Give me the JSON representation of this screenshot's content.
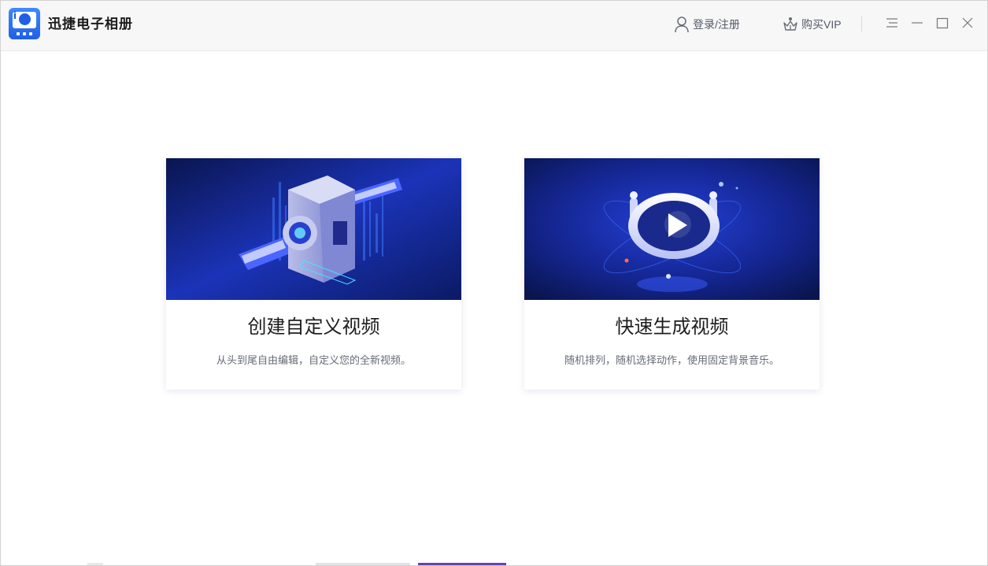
{
  "app": {
    "title": "迅捷电子相册"
  },
  "header": {
    "login_label": "登录/注册",
    "vip_label": "购买VIP"
  },
  "cards": [
    {
      "title": "创建自定义视频",
      "desc": "从头到尾自由编辑，自定义您的全新视频。"
    },
    {
      "title": "快速生成视频",
      "desc": "随机排列，随机选择动作，使用固定背景音乐。"
    }
  ],
  "colors": {
    "accent": "#1f5fe6",
    "banner_dark": "#0a1a5c",
    "banner_mid": "#1530a8"
  },
  "icons": [
    "app-logo",
    "user-icon",
    "crown-icon",
    "menu-icon",
    "minimize-icon",
    "maximize-icon",
    "close-icon",
    "play-icon"
  ]
}
